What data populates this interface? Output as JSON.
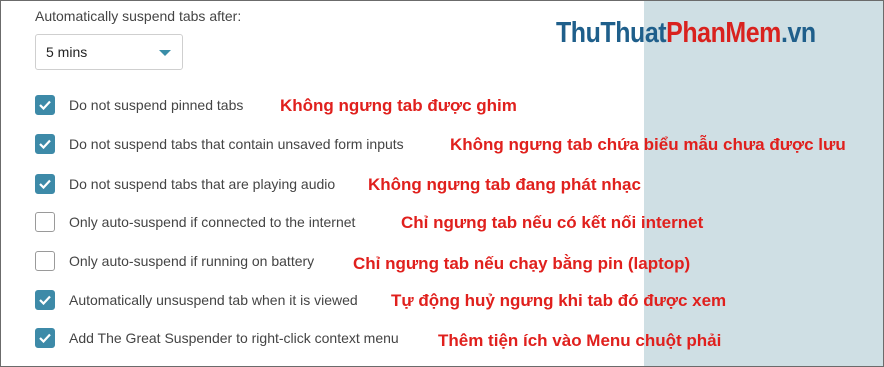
{
  "heading": "Automatically suspend tabs after:",
  "dropdown": {
    "selected": "5 mins"
  },
  "watermark": {
    "main": "ThuThuat",
    "accent": "PhanMem",
    "suffix": ".vn"
  },
  "colors": {
    "accent": "#3d8aa8",
    "annotation": "#e0201d",
    "side_panel": "#cfdfe4"
  },
  "options": [
    {
      "label": "Do not suspend pinned tabs",
      "checked": true,
      "note": "Không ngưng tab được ghim"
    },
    {
      "label": "Do not suspend tabs that contain unsaved form inputs",
      "checked": true,
      "note": "Không ngưng tab chứa biểu mẫu chưa được lưu"
    },
    {
      "label": "Do not suspend tabs that are playing audio",
      "checked": true,
      "note": "Không ngưng tab đang phát nhạc"
    },
    {
      "label": "Only auto-suspend if connected to the internet",
      "checked": false,
      "note": "Chỉ ngưng tab nếu có kết nối internet"
    },
    {
      "label": "Only auto-suspend if running on battery",
      "checked": false,
      "note": "Chỉ ngưng tab nếu chạy bằng pin (laptop)"
    },
    {
      "label": "Automatically unsuspend tab when it is viewed",
      "checked": true,
      "note": "Tự động huỷ ngưng khi tab đó được xem"
    },
    {
      "label": "Add The Great Suspender to right-click context menu",
      "checked": true,
      "note": "Thêm tiện ích vào Menu chuột phải"
    }
  ]
}
